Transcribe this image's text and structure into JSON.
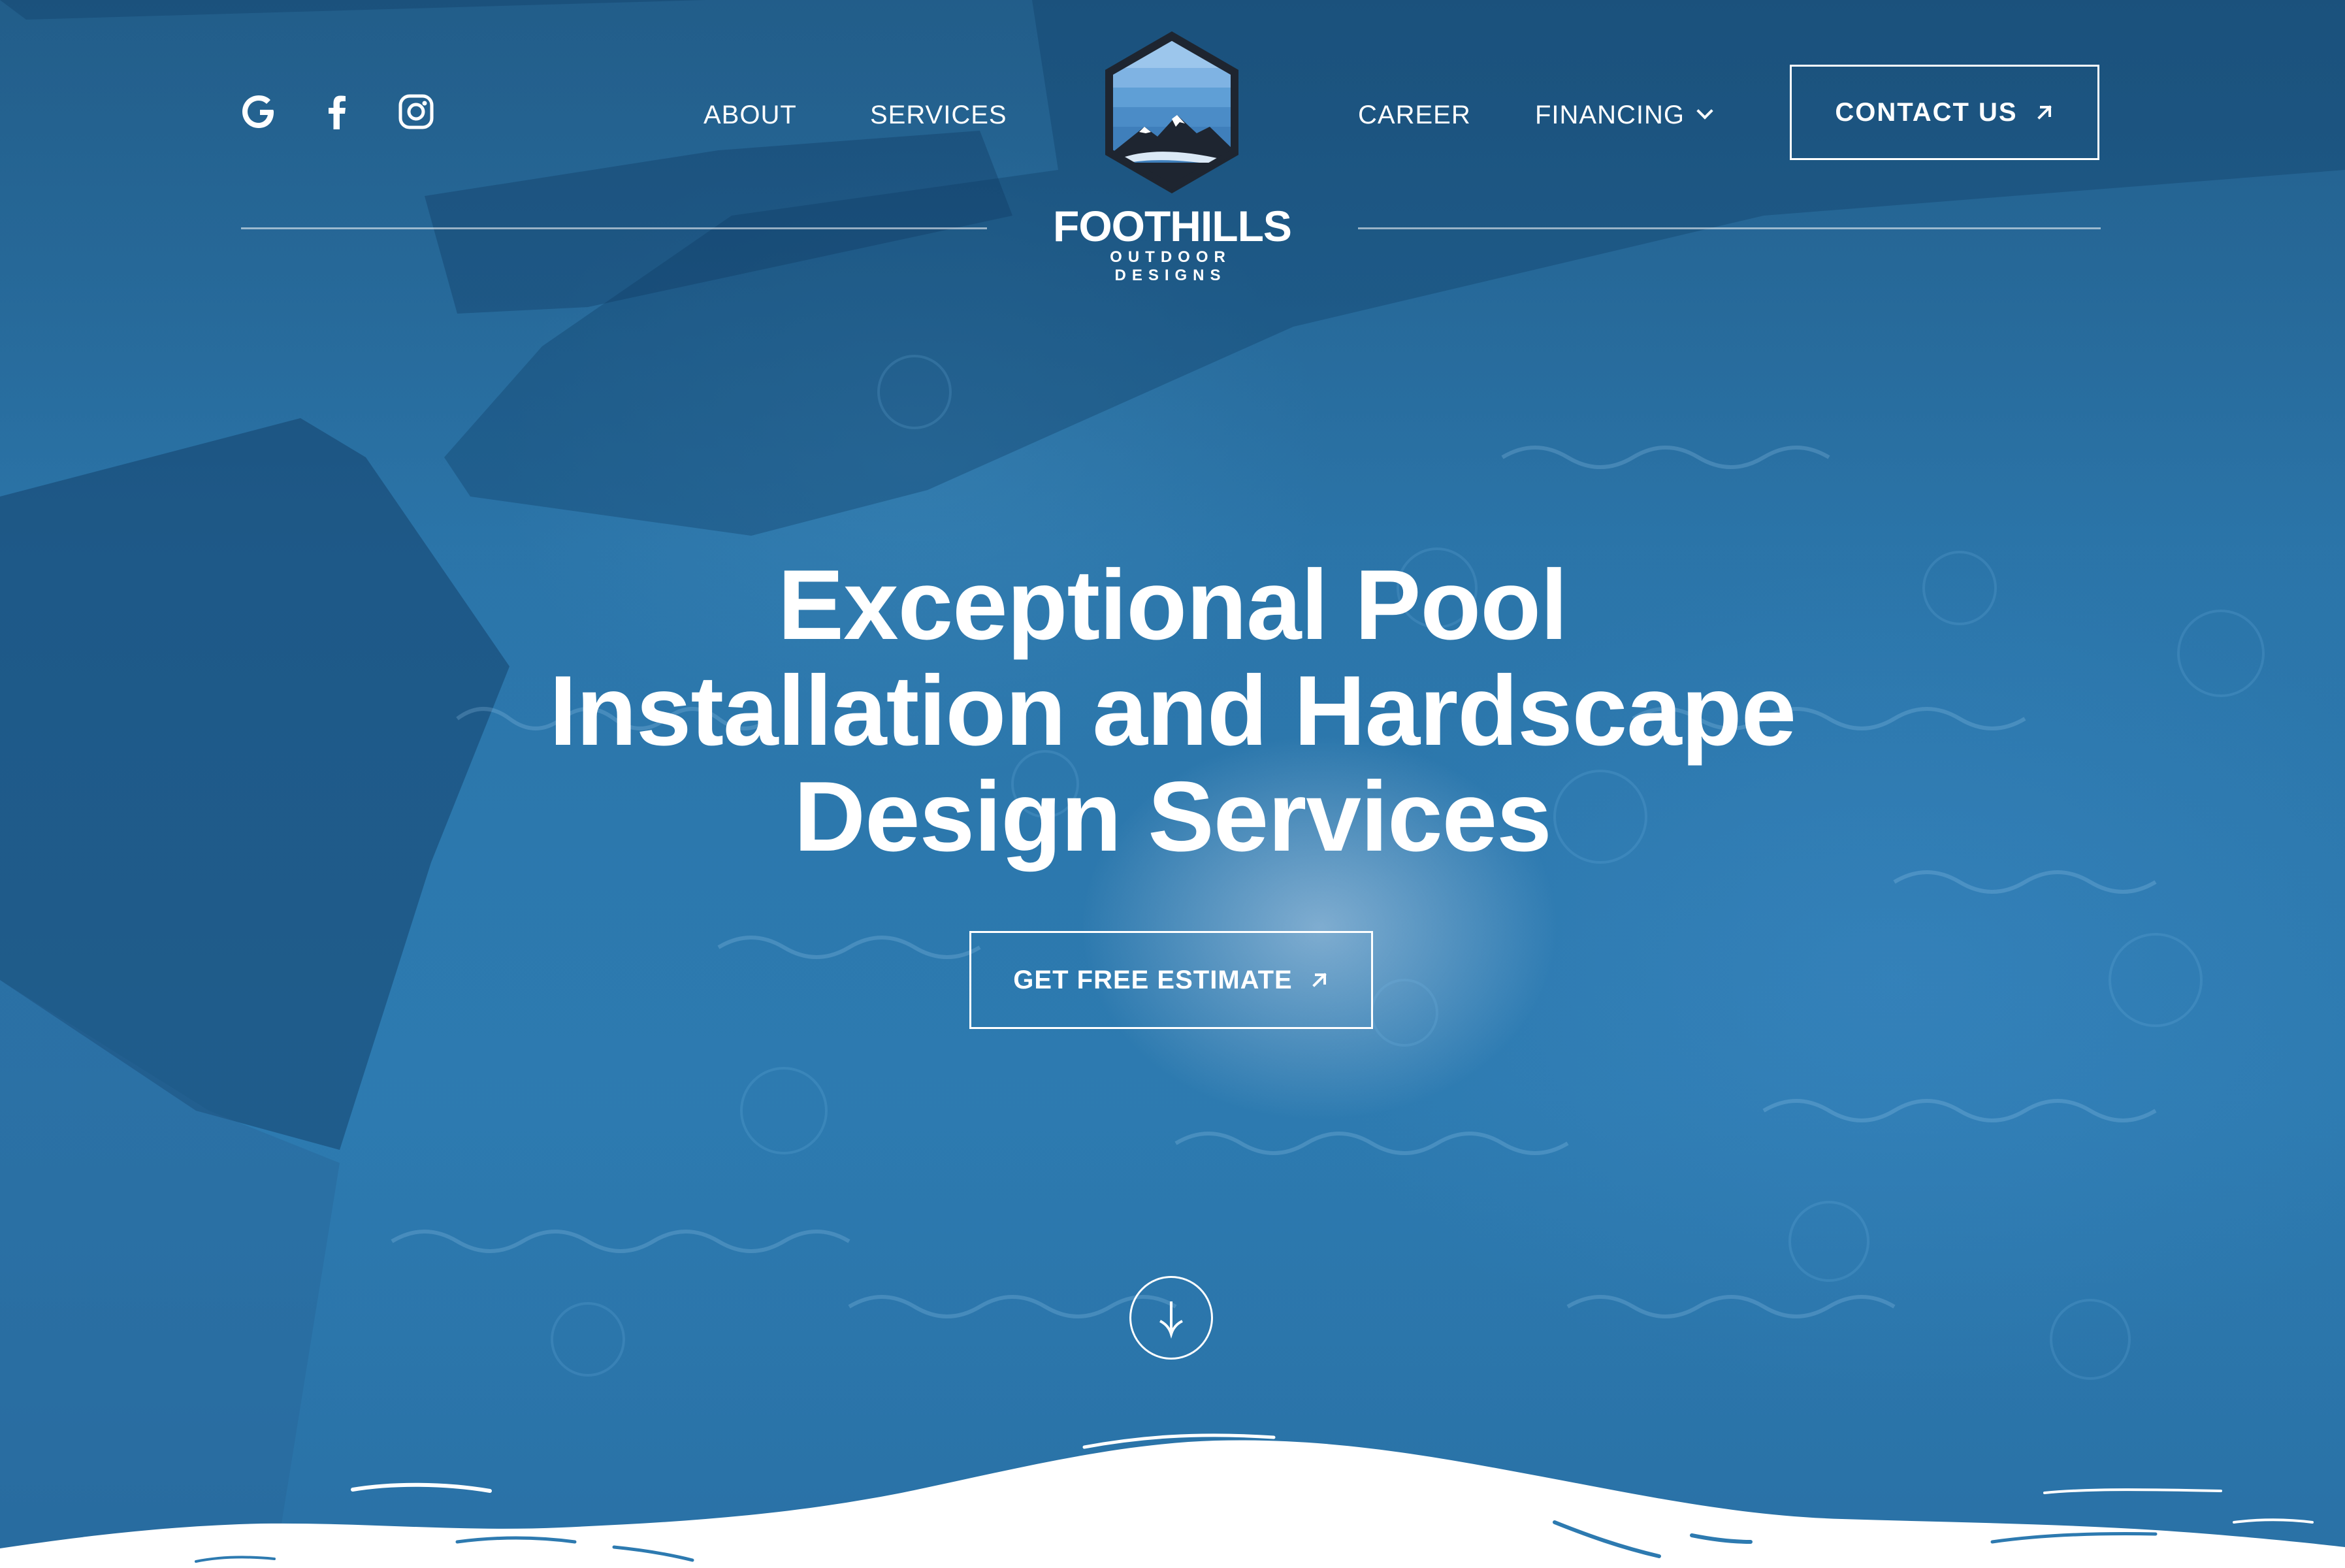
{
  "brand": {
    "name": "FOOTHILLS",
    "tagline": "OUTDOOR DESIGNS"
  },
  "social": [
    {
      "icon": "google-icon"
    },
    {
      "icon": "facebook-icon"
    },
    {
      "icon": "instagram-icon"
    }
  ],
  "nav": {
    "about": "ABOUT",
    "services": "SERVICES",
    "career": "CAREER",
    "financing": "FINANCING"
  },
  "contact": {
    "label": "CONTACT US",
    "icon": "arrow-up-right-icon"
  },
  "hero": {
    "headline_lines": [
      "Exceptional Pool",
      "Installation and Hardscape",
      "Design Services"
    ],
    "cta_label": "GET FREE ESTIMATE",
    "cta_icon": "arrow-up-right-icon",
    "scroll_icon": "arrow-down-icon"
  },
  "colors": {
    "water": "#2d7ab0",
    "accent_white": "#ffffff",
    "logo_dark": "#1e2530",
    "logo_sky": "#5f9fd6"
  }
}
